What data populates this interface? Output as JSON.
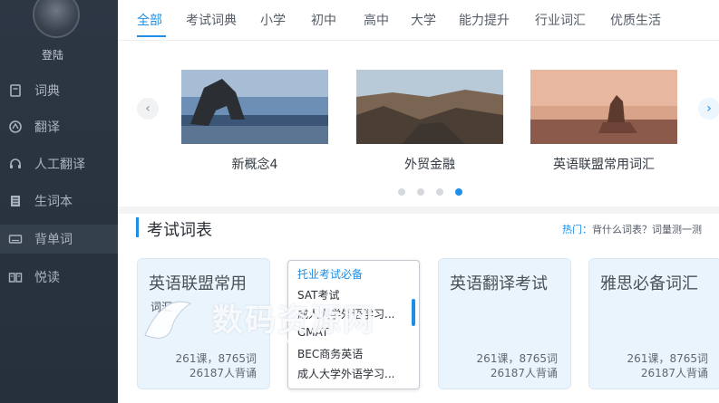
{
  "sidebar": {
    "login_label": "登陆",
    "items": [
      {
        "label": "词典",
        "icon": "book-icon"
      },
      {
        "label": "翻译",
        "icon": "translate-icon"
      },
      {
        "label": "人工翻译",
        "icon": "headset-icon"
      },
      {
        "label": "生词本",
        "icon": "notebook-icon"
      },
      {
        "label": "背单词",
        "icon": "keyboard-icon"
      },
      {
        "label": "悦读",
        "icon": "open-book-icon"
      }
    ]
  },
  "tabs": [
    "全部",
    "考试词典",
    "小学",
    "初中",
    "高中",
    "大学",
    "能力提升",
    "行业词汇",
    "优质生活"
  ],
  "carousel": {
    "prev": "‹",
    "next": "›",
    "cards": [
      {
        "label": "新概念4"
      },
      {
        "label": "外贸金融"
      },
      {
        "label": "英语联盟常用词汇"
      }
    ],
    "active_dot": 4,
    "dot_count": 4
  },
  "section": {
    "title": "考试词表",
    "hot_label": "热门",
    "hot_colon": "：",
    "hot_text": "背什么词表？词量测一测"
  },
  "word_cards": [
    {
      "title": "英语联盟常用",
      "sub": "词汇",
      "stat1": "261课，8765词",
      "stat2": "26187人背诵"
    },
    {
      "title": "英语翻译考试",
      "stat1": "261课，8765词",
      "stat2": "26187人背诵"
    },
    {
      "title": "雅思必备词汇",
      "stat1": "261课，8765词",
      "stat2": "26187人背诵"
    }
  ],
  "dropdown": {
    "items": [
      "托业考试必备",
      "SAT考试",
      "成人大学外语学习...",
      "GMAT",
      "BEC商务英语",
      "成人大学外语学习..."
    ]
  },
  "watermark": {
    "text": "数码资源网",
    "url": "www.smzy.com"
  },
  "colors": {
    "accent": "#1e8ee6",
    "sidebar_bg": "#2d3744"
  }
}
